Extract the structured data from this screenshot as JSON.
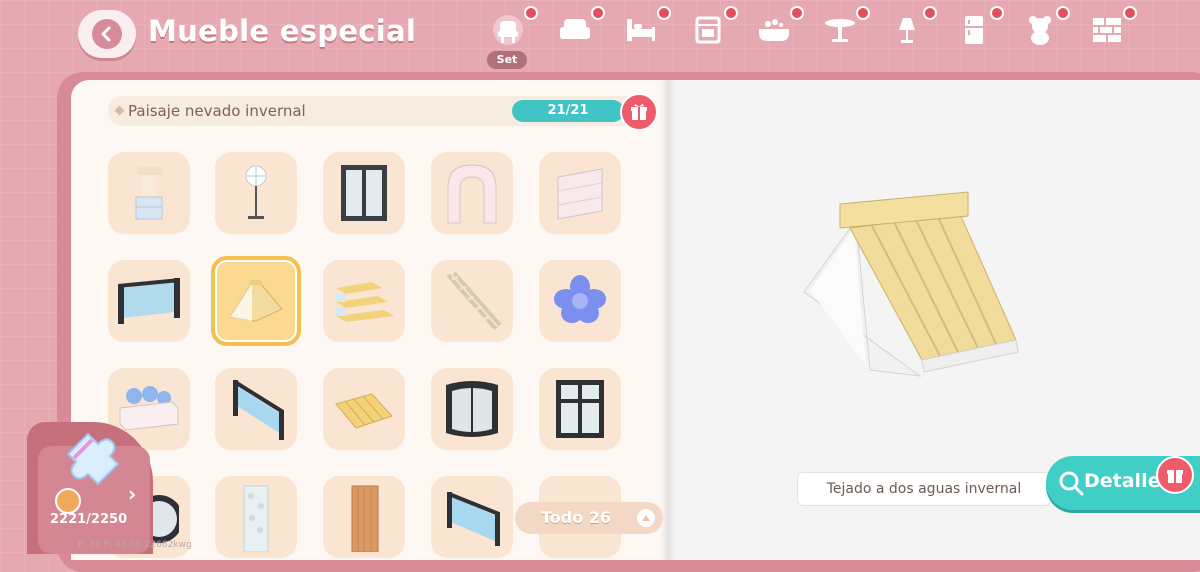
{
  "header": {
    "title": "Mueble especial",
    "set_label": "Set",
    "tabs": [
      {
        "icon": "set-chair-icon",
        "active": true
      },
      {
        "icon": "armchair-icon"
      },
      {
        "icon": "bed-icon"
      },
      {
        "icon": "oven-icon"
      },
      {
        "icon": "bathtub-icon"
      },
      {
        "icon": "table-icon"
      },
      {
        "icon": "lamp-icon"
      },
      {
        "icon": "fridge-icon"
      },
      {
        "icon": "teddy-bear-icon"
      },
      {
        "icon": "brick-wall-icon"
      }
    ]
  },
  "set_bar": {
    "name": "Paisaje nevado invernal",
    "count": "21/21"
  },
  "grid": {
    "items": [
      {
        "icon": "pillar-icon"
      },
      {
        "icon": "snowflake-lamp-icon"
      },
      {
        "icon": "window-icon"
      },
      {
        "icon": "arch-icon"
      },
      {
        "icon": "wall-panel-icon"
      },
      {
        "icon": "glass-fence-icon"
      },
      {
        "icon": "gable-roof-icon",
        "selected": true
      },
      {
        "icon": "stairs-icon"
      },
      {
        "icon": "ladder-stairs-icon"
      },
      {
        "icon": "blue-flower-icon"
      },
      {
        "icon": "flower-planter-icon"
      },
      {
        "icon": "stair-railing-icon"
      },
      {
        "icon": "awning-icon"
      },
      {
        "icon": "curved-window-icon"
      },
      {
        "icon": "grid-window-icon"
      },
      {
        "icon": "round-mirror-icon"
      },
      {
        "icon": "stone-column-icon"
      },
      {
        "icon": "wood-plank-icon"
      },
      {
        "icon": "glass-railing-icon"
      },
      {
        "icon": "dark-roof-icon"
      }
    ]
  },
  "footer": {
    "collection_count": "2221/2250",
    "debug": "P: 30    P: 43    ID: 22662kwg",
    "filter_label": "Todo 26"
  },
  "preview": {
    "item_name": "Tejado a dos aguas invernal",
    "details_label": "Detalles"
  },
  "colors": {
    "accent_teal": "#3fcfc6",
    "gift_red": "#ee5c6b",
    "frame_pink": "#e6a9b2"
  }
}
